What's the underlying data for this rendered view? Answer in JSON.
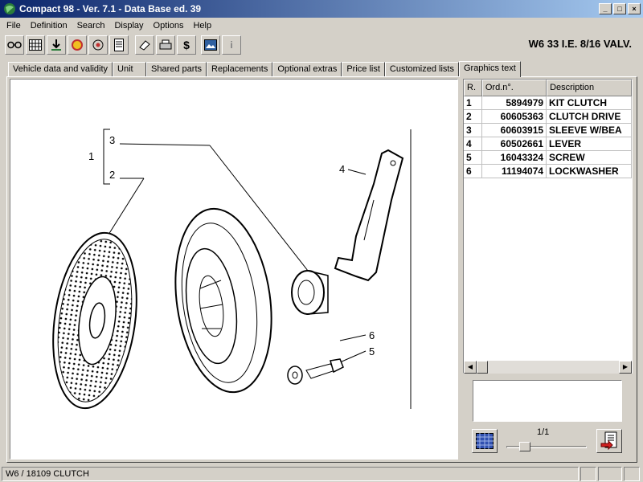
{
  "window": {
    "title": "Compact 98  -  Ver. 7.1  -  Data Base ed. 39",
    "minimize": "_",
    "maximize": "□",
    "close": "×"
  },
  "menu": [
    "File",
    "Definition",
    "Search",
    "Display",
    "Options",
    "Help"
  ],
  "toolbar": {
    "buttons": [
      "glasses-icon",
      "grid-icon",
      "download-icon",
      "color-icon",
      "target-icon",
      "document-icon",
      "eraser-icon",
      "print-icon",
      "dollar-icon",
      "image-icon",
      "info-icon"
    ],
    "dollar": "$",
    "info": "i"
  },
  "vehicle_title": "W6 33 I.E. 8/16 VALV.",
  "tabs": [
    "Vehicle data and validity",
    "Unit",
    "Shared parts",
    "Replacements",
    "Optional extras",
    "Price list",
    "Customized lists",
    "Graphics text"
  ],
  "active_tab": "Graphics text",
  "drawing": {
    "labels": [
      "1",
      "2",
      "3",
      "4",
      "5",
      "6"
    ]
  },
  "parts": {
    "columns": [
      "R.",
      "Ord.n°.",
      "Description"
    ],
    "rows": [
      {
        "r": "1",
        "ord": "5894979",
        "desc": "KIT CLUTCH"
      },
      {
        "r": "2",
        "ord": "60605363",
        "desc": "CLUTCH DRIVE"
      },
      {
        "r": "3",
        "ord": "60603915",
        "desc": "SLEEVE W/BEA"
      },
      {
        "r": "4",
        "ord": "60502661",
        "desc": "LEVER"
      },
      {
        "r": "5",
        "ord": "16043324",
        "desc": "SCREW"
      },
      {
        "r": "6",
        "ord": "11194074",
        "desc": "LOCKWASHER"
      }
    ]
  },
  "page_indicator": "1/1",
  "status": {
    "text": "W6 / 18109  CLUTCH"
  }
}
